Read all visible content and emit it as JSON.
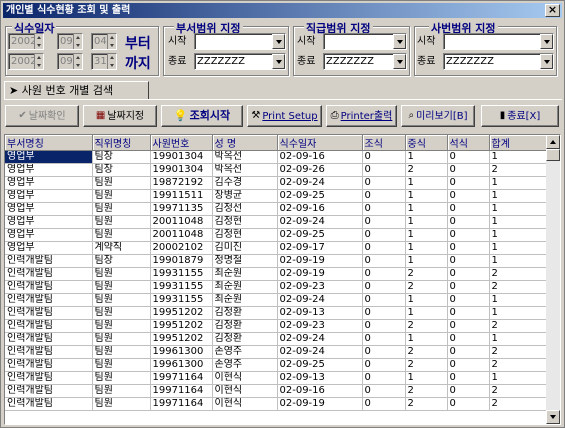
{
  "window": {
    "title": "개인별 식수현황 조회 및 출력",
    "close": "×"
  },
  "date_group": {
    "title": "식수일자",
    "from": {
      "year": "2002",
      "month": "09",
      "day": "04"
    },
    "to": {
      "year": "2002",
      "month": "09",
      "day": "31"
    },
    "from_label": "부터",
    "to_label": "까지"
  },
  "dept_group": {
    "title": "부서범위 지정",
    "start_label": "시작",
    "end_label": "종료",
    "start_value": "",
    "end_value": "ZZZZZZZ"
  },
  "rank_group": {
    "title": "직급범위 지정",
    "start_label": "시작",
    "end_label": "종료",
    "start_value": "",
    "end_value": "ZZZZZZZ"
  },
  "emp_group": {
    "title": "사번범위 지정",
    "start_label": "시작",
    "end_label": "종료",
    "start_value": "",
    "end_value": "ZZZZZZZ"
  },
  "tab": {
    "label": "사원 번호 개별 검색"
  },
  "toolbar": {
    "date_confirm": "날짜확인",
    "date_set": "날짜지정",
    "search": "조회시작",
    "print_setup": "Print Setup",
    "printer_out": "Printer출력",
    "preview": "미리보기[B]",
    "exit": "종료[X]"
  },
  "table": {
    "columns": [
      "부서명칭",
      "직위명칭",
      "사원번호",
      "성    명",
      "식수일자",
      "조식",
      "중식",
      "석식",
      "합계"
    ],
    "rows": [
      [
        "영업부",
        "팀장",
        "19901304",
        "박옥선",
        "02-09-16",
        "0",
        "1",
        "0",
        "1"
      ],
      [
        "영업부",
        "팀장",
        "19901304",
        "박옥선",
        "02-09-26",
        "0",
        "2",
        "0",
        "2"
      ],
      [
        "영업부",
        "팀원",
        "19872192",
        "김수경",
        "02-09-24",
        "0",
        "1",
        "0",
        "1"
      ],
      [
        "영업부",
        "팀원",
        "19911511",
        "창병균",
        "02-09-25",
        "0",
        "1",
        "0",
        "1"
      ],
      [
        "영업부",
        "팀원",
        "19971135",
        "김정선",
        "02-09-16",
        "0",
        "1",
        "0",
        "1"
      ],
      [
        "영업부",
        "팀원",
        "20011048",
        "김정현",
        "02-09-24",
        "0",
        "1",
        "0",
        "1"
      ],
      [
        "영업부",
        "팀원",
        "20011048",
        "김정현",
        "02-09-25",
        "0",
        "1",
        "0",
        "1"
      ],
      [
        "영업부",
        "계약직",
        "20002102",
        "김미진",
        "02-09-17",
        "0",
        "1",
        "0",
        "1"
      ],
      [
        "인력개발팀",
        "팀장",
        "19901879",
        "정명철",
        "02-09-19",
        "0",
        "1",
        "0",
        "1"
      ],
      [
        "인력개발팀",
        "팀원",
        "19931155",
        "최순원",
        "02-09-19",
        "0",
        "2",
        "0",
        "2"
      ],
      [
        "인력개발팀",
        "팀원",
        "19931155",
        "최순원",
        "02-09-23",
        "0",
        "2",
        "0",
        "2"
      ],
      [
        "인력개발팀",
        "팀원",
        "19931155",
        "최순원",
        "02-09-24",
        "0",
        "1",
        "0",
        "1"
      ],
      [
        "인력개발팀",
        "팀원",
        "19951202",
        "김정환",
        "02-09-13",
        "0",
        "1",
        "0",
        "1"
      ],
      [
        "인력개발팀",
        "팀원",
        "19951202",
        "김정환",
        "02-09-23",
        "0",
        "2",
        "0",
        "2"
      ],
      [
        "인력개발팀",
        "팀원",
        "19951202",
        "김정환",
        "02-09-24",
        "0",
        "1",
        "0",
        "1"
      ],
      [
        "인력개발팀",
        "팀원",
        "19961300",
        "손영주",
        "02-09-24",
        "0",
        "2",
        "0",
        "2"
      ],
      [
        "인력개발팀",
        "팀원",
        "19961300",
        "손영주",
        "02-09-25",
        "0",
        "2",
        "0",
        "2"
      ],
      [
        "인력개발팀",
        "팀원",
        "19971164",
        "이현식",
        "02-09-13",
        "0",
        "1",
        "0",
        "1"
      ],
      [
        "인력개발팀",
        "팀원",
        "19971164",
        "이현식",
        "02-09-16",
        "0",
        "2",
        "0",
        "2"
      ],
      [
        "인력개발팀",
        "팀원",
        "19971164",
        "이현식",
        "02-09-19",
        "0",
        "2",
        "0",
        "2"
      ]
    ]
  }
}
